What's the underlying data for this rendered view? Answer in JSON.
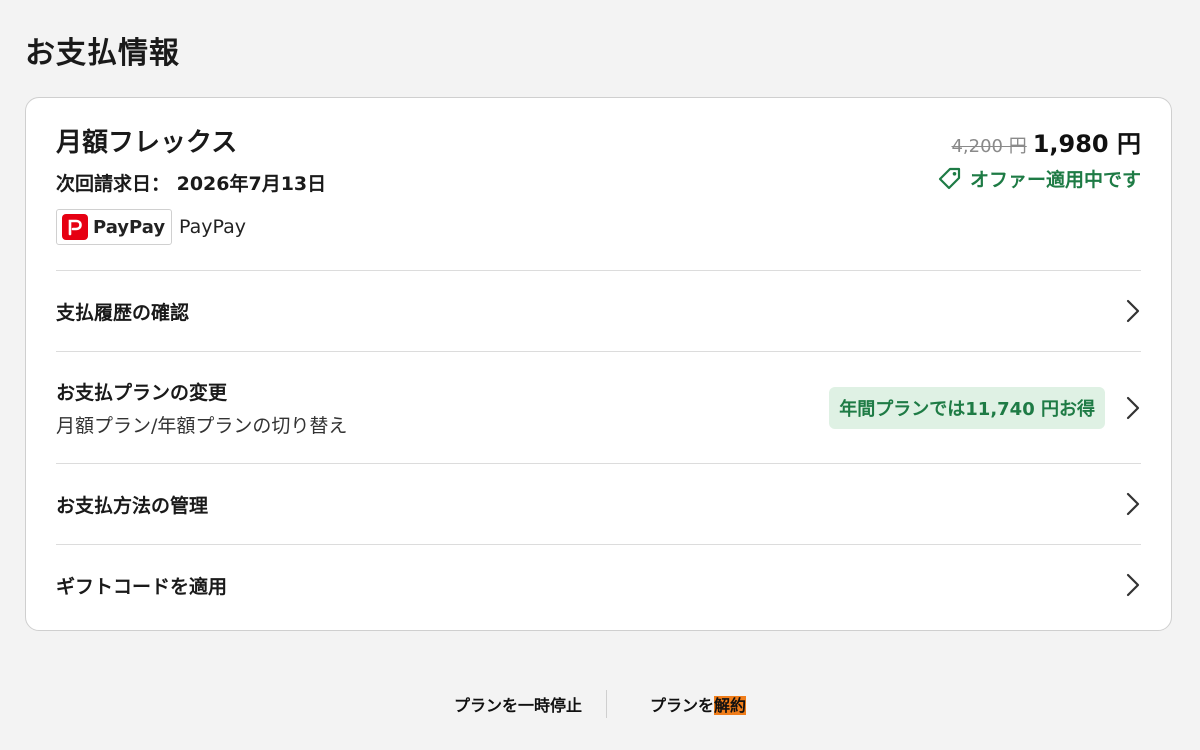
{
  "page": {
    "title": "お支払情報"
  },
  "plan": {
    "name": "月額フレックス",
    "next_billing": "次回請求日： 2026年7月13日",
    "payment_logo_text": "PayPay",
    "payment_method": "PayPay",
    "price_original": "4,200 円",
    "price_current": "1,980 円",
    "offer_label": "オファー適用中です"
  },
  "rows": [
    {
      "label": "支払履歴の確認"
    },
    {
      "label": "お支払プランの変更",
      "sub": "月額プラン/年額プランの切り替え",
      "badge": "年間プランでは11,740 円お得"
    },
    {
      "label": "お支払方法の管理"
    },
    {
      "label": "ギフトコードを適用"
    }
  ],
  "footer": {
    "pause_label": "プランを一時停止",
    "cancel_prefix": "プランを",
    "cancel_highlight": "解約"
  },
  "colors": {
    "accent_green": "#1e7b45",
    "badge_bg": "#dff1e4",
    "paypay_red": "#e60012",
    "highlight": "#f07d1a"
  }
}
